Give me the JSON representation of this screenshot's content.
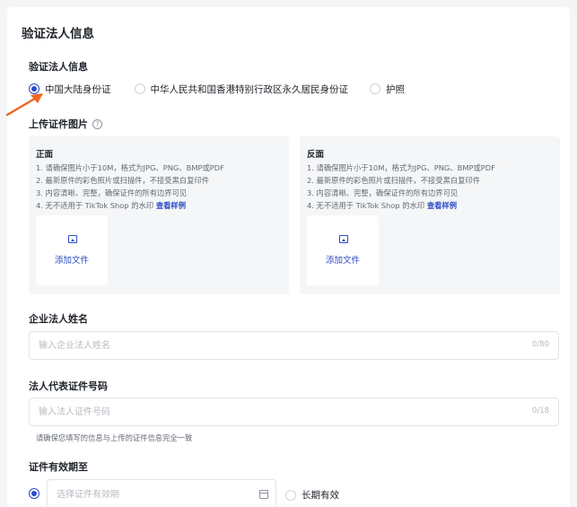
{
  "section_title": "验证法人信息",
  "id_type": {
    "label": "验证法人信息",
    "options": [
      {
        "label": "中国大陆身份证",
        "selected": true
      },
      {
        "label": "中华人民共和国香港特别行政区永久居民身份证",
        "selected": false
      },
      {
        "label": "护照",
        "selected": false
      }
    ]
  },
  "upload": {
    "label": "上传证件图片",
    "help_icon_glyph": "?",
    "front": {
      "title": "正面",
      "requirements": [
        "1. 请确保图片小于10M，格式为JPG、PNG、BMP或PDF",
        "2. 最新原件的彩色照片或扫描件，不接受黑白复印件",
        "3. 内容清晰、完整，确保证件的所有边界可见",
        "4. 无不适用于 TikTok Shop 的水印"
      ],
      "example_link": "查看样例",
      "add_file": "添加文件"
    },
    "back": {
      "title": "反面",
      "requirements": [
        "1. 请确保图片小于10M，格式为JPG、PNG、BMP或PDF",
        "2. 最新原件的彩色照片或扫描件，不接受黑白复印件",
        "3. 内容清晰、完整，确保证件的所有边界可见",
        "4. 无不适用于 TikTok Shop 的水印"
      ],
      "example_link": "查看样例",
      "add_file": "添加文件"
    }
  },
  "legal_name": {
    "label": "企业法人姓名",
    "placeholder": "输入企业法人姓名",
    "value": "",
    "counter": "0/80"
  },
  "id_number": {
    "label": "法人代表证件号码",
    "placeholder": "输入法人证件号码",
    "value": "",
    "counter": "0/18",
    "hint": "请确保您填写的信息与上传的证件信息完全一致"
  },
  "expiry": {
    "label": "证件有效期至",
    "date_placeholder": "选择证件有效期",
    "date_selected": true,
    "long_term_label": "长期有效",
    "long_term_selected": false
  },
  "colors": {
    "accent": "#2a4bc4",
    "annotation_arrow": "#f0641e"
  },
  "icons": {
    "help": "help-circle-icon",
    "upload": "image-icon",
    "calendar": "calendar-icon",
    "annotation": "arrow-annotation-icon"
  }
}
